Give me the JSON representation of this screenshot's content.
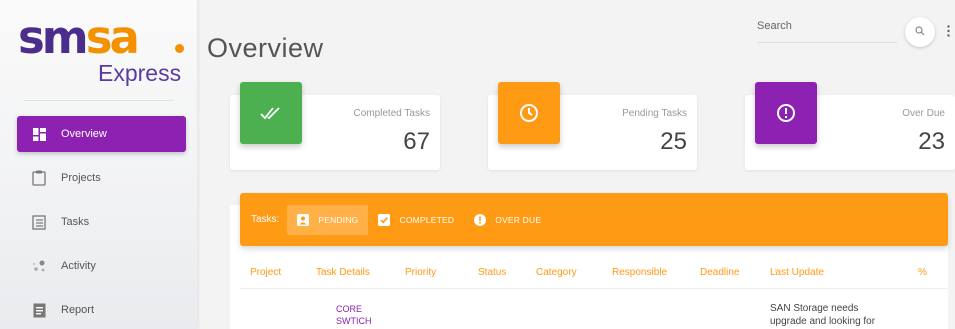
{
  "brand": {
    "logo_part1": "sm",
    "logo_part2": "sa",
    "logo_sub": "Express",
    "colors": {
      "purple": "#4b2d8c",
      "orange": "#f39200"
    }
  },
  "sidebar": {
    "items": [
      {
        "label": "Overview",
        "icon": "dashboard-icon",
        "active": true
      },
      {
        "label": "Projects",
        "icon": "clipboard-icon",
        "active": false
      },
      {
        "label": "Tasks",
        "icon": "list-icon",
        "active": false
      },
      {
        "label": "Activity",
        "icon": "activity-icon",
        "active": false
      },
      {
        "label": "Report",
        "icon": "report-icon",
        "active": false
      }
    ]
  },
  "header": {
    "title": "Overview",
    "search_placeholder": "Search"
  },
  "cards": [
    {
      "label": "Completed Tasks",
      "value": "67",
      "icon": "double-check-icon",
      "color": "#4caf50"
    },
    {
      "label": "Pending Tasks",
      "value": "25",
      "icon": "clock-icon",
      "color": "#ff9a14"
    },
    {
      "label": "Over Due",
      "value": "23",
      "icon": "alert-circle-icon",
      "color": "#8d22b2"
    }
  ],
  "tasks": {
    "label": "Tasks:",
    "tabs": [
      {
        "label": "PENDING",
        "icon": "person-icon",
        "active": true
      },
      {
        "label": "COMPLETED",
        "icon": "check-square-icon",
        "active": false
      },
      {
        "label": "OVER DUE",
        "icon": "alert-circle-icon",
        "active": false
      }
    ],
    "columns": [
      "Project",
      "Task Details",
      "Priority",
      "Status",
      "Category",
      "Responsible",
      "Deadline",
      "Last Update",
      "%"
    ],
    "rows": [
      {
        "project": "",
        "task_details_line1": "CORE",
        "task_details_line2": "SWTICH",
        "last_update_line1": "SAN Storage needs",
        "last_update_line2": "upgrade and looking for"
      }
    ]
  }
}
